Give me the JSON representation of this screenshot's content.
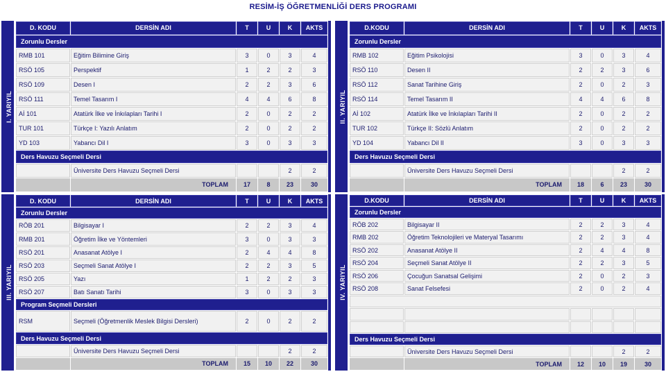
{
  "title": "RESİM-İŞ ÖĞRETMENLİĞİ DERS PROGRAMI",
  "colors": {
    "brand_blue": "#1f1f8f",
    "text_blue": "#1b1b6e",
    "cell_bg": "#f1f1f1",
    "total_bg": "#c8c8c8"
  },
  "headers": {
    "code": "D. KODU",
    "code_alt": "D.KODU",
    "name": "DERSİN ADI",
    "t": "T",
    "u": "U",
    "k": "K",
    "akts": "AKTS"
  },
  "bands": {
    "zorunlu": "Zorunlu Dersler",
    "zorunlu_wide": "Zorunlu  Dersler",
    "program_secmeli": "Program Seçmeli Dersleri",
    "havuz": "Ders Havuzu Seçmeli Dersi"
  },
  "labels": {
    "toplam": "TOPLAM",
    "havuz_dersi": "Üniversite Ders Havuzu Seçmeli  Dersi"
  },
  "semesters": [
    {
      "id": "sem1",
      "vertical_label": "I. YARIYIL",
      "header_code": "D. KODU",
      "band_zorunlu": "Zorunlu Dersler",
      "rows": [
        {
          "code": "RMB 101",
          "name": "Eğitim Bilimine Giriş",
          "t": "3",
          "u": "0",
          "k": "3",
          "akts": "4"
        },
        {
          "code": "RSÖ 105",
          "name": "Perspektif",
          "t": "1",
          "u": "2",
          "k": "2",
          "akts": "3"
        },
        {
          "code": "RSÖ 109",
          "name": "Desen I",
          "t": "2",
          "u": "2",
          "k": "3",
          "akts": "6"
        },
        {
          "code": "RSÖ 111",
          "name": "Temel Tasarım I",
          "t": "4",
          "u": "4",
          "k": "6",
          "akts": "8"
        },
        {
          "code": "Aİ 101",
          "name": "Atatürk İlke ve İnkılapları Tarihi I",
          "t": "2",
          "u": "0",
          "k": "2",
          "akts": "2"
        },
        {
          "code": "TUR 101",
          "name": "Türkçe I: Yazılı Anlatım",
          "t": "2",
          "u": "0",
          "k": "2",
          "akts": "2"
        },
        {
          "code": "YD 103",
          "name": "Yabancı Dil I",
          "t": "3",
          "u": "0",
          "k": "3",
          "akts": "3"
        }
      ],
      "pool_row": {
        "code": "",
        "name": "Üniversite Ders Havuzu Seçmeli  Dersi",
        "t": "",
        "u": "",
        "k": "2",
        "akts": "2"
      },
      "total": {
        "label": "TOPLAM",
        "t": "17",
        "u": "8",
        "k": "23",
        "akts": "30"
      }
    },
    {
      "id": "sem2",
      "vertical_label": "II. YARIYIL",
      "header_code": "D.KODU",
      "band_zorunlu": "Zorunlu Dersler",
      "rows": [
        {
          "code": "RMB 102",
          "name": "Eğitim Psikolojisi",
          "t": "3",
          "u": "0",
          "k": "3",
          "akts": "4"
        },
        {
          "code": "RSÖ 110",
          "name": "Desen II",
          "t": "2",
          "u": "2",
          "k": "3",
          "akts": "6"
        },
        {
          "code": "RSÖ 112",
          "name": "Sanat Tarihine Giriş",
          "t": "2",
          "u": "0",
          "k": "2",
          "akts": "3"
        },
        {
          "code": "RSÖ 114",
          "name": "Temel Tasarım II",
          "t": "4",
          "u": "4",
          "k": "6",
          "akts": "8"
        },
        {
          "code": "Aİ 102",
          "name": "Atatürk İlke ve İnkılapları Tarihi II",
          "t": "2",
          "u": "0",
          "k": "2",
          "akts": "2"
        },
        {
          "code": "TUR 102",
          "name": "Türkçe II: Sözlü Anlatım",
          "t": "2",
          "u": "0",
          "k": "2",
          "akts": "2"
        },
        {
          "code": "YD 104",
          "name": "Yabancı Dil II",
          "t": "3",
          "u": "0",
          "k": "3",
          "akts": "3"
        }
      ],
      "pool_row": {
        "code": "",
        "name": "Üniversite Ders Havuzu Seçmeli  Dersi",
        "t": "",
        "u": "",
        "k": "2",
        "akts": "2"
      },
      "total": {
        "label": "TOPLAM",
        "t": "18",
        "u": "6",
        "k": "23",
        "akts": "30"
      }
    },
    {
      "id": "sem3",
      "vertical_label": "III. YARIYIL",
      "header_code": "D. KODU",
      "band_zorunlu": "Zorunlu  Dersler",
      "rows": [
        {
          "code": "RÖB 201",
          "name": "Bilgisayar I",
          "t": "2",
          "u": "2",
          "k": "3",
          "akts": "4"
        },
        {
          "code": "RMB 201",
          "name": "Öğretim İlke ve Yöntemleri",
          "t": "3",
          "u": "0",
          "k": "3",
          "akts": "3"
        },
        {
          "code": "RSÖ 201",
          "name": "Anasanat Atölye I",
          "t": "2",
          "u": "4",
          "k": "4",
          "akts": "8"
        },
        {
          "code": "RSÖ 203",
          "name": "Seçmeli Sanat Atölye I",
          "t": "2",
          "u": "2",
          "k": "3",
          "akts": "5"
        },
        {
          "code": "RSÖ 205",
          "name": "Yazı",
          "t": "1",
          "u": "2",
          "k": "2",
          "akts": "3"
        },
        {
          "code": "RSÖ 207",
          "name": "Batı Sanatı Tarihi",
          "t": "3",
          "u": "0",
          "k": "3",
          "akts": "3"
        }
      ],
      "band_program": "Program Seçmeli Dersleri",
      "program_rows": [
        {
          "code": "RSM",
          "name": "Seçmeli (Öğretmenlik Meslek Bilgisi Dersleri)",
          "t": "2",
          "u": "0",
          "k": "2",
          "akts": "2"
        }
      ],
      "pool_row": {
        "code": "",
        "name": "Üniversite Ders Havuzu Seçmeli  Dersi",
        "t": "",
        "u": "",
        "k": "2",
        "akts": "2"
      },
      "total": {
        "label": "TOPLAM",
        "t": "15",
        "u": "10",
        "k": "22",
        "akts": "30"
      }
    },
    {
      "id": "sem4",
      "vertical_label": "IV. YARIYIL",
      "header_code": "D.KODU",
      "band_zorunlu": "Zorunlu Dersler",
      "rows": [
        {
          "code": "RÖB 202",
          "name": "Bilgisayar II",
          "t": "2",
          "u": "2",
          "k": "3",
          "akts": "4"
        },
        {
          "code": "RMB 202",
          "name": "Öğretim Teknolojileri ve Materyal Tasarımı",
          "t": "2",
          "u": "2",
          "k": "3",
          "akts": "4"
        },
        {
          "code": "RSÖ 202",
          "name": "Anasanat Atölye II",
          "t": "2",
          "u": "4",
          "k": "4",
          "akts": "8"
        },
        {
          "code": "RSÖ 204",
          "name": "Seçmeli Sanat Atölye II",
          "t": "2",
          "u": "2",
          "k": "3",
          "akts": "5"
        },
        {
          "code": "RSÖ 206",
          "name": "Çocuğun Sanatsal Gelişimi",
          "t": "2",
          "u": "0",
          "k": "2",
          "akts": "3"
        },
        {
          "code": "RSÖ 208",
          "name": "Sanat Felsefesi",
          "t": "2",
          "u": "0",
          "k": "2",
          "akts": "4"
        },
        {
          "code": "",
          "name": "",
          "t": "",
          "u": "",
          "k": "",
          "akts": "",
          "blank": true
        },
        {
          "code": "",
          "name": "",
          "t": "",
          "u": "",
          "k": "",
          "akts": "",
          "blank": true
        }
      ],
      "pool_row": {
        "code": "",
        "name": "Üniversite Ders Havuzu Seçmeli  Dersi",
        "t": "",
        "u": "",
        "k": "2",
        "akts": "2"
      },
      "total": {
        "label": "TOPLAM",
        "t": "12",
        "u": "10",
        "k": "19",
        "akts": "30"
      }
    }
  ]
}
